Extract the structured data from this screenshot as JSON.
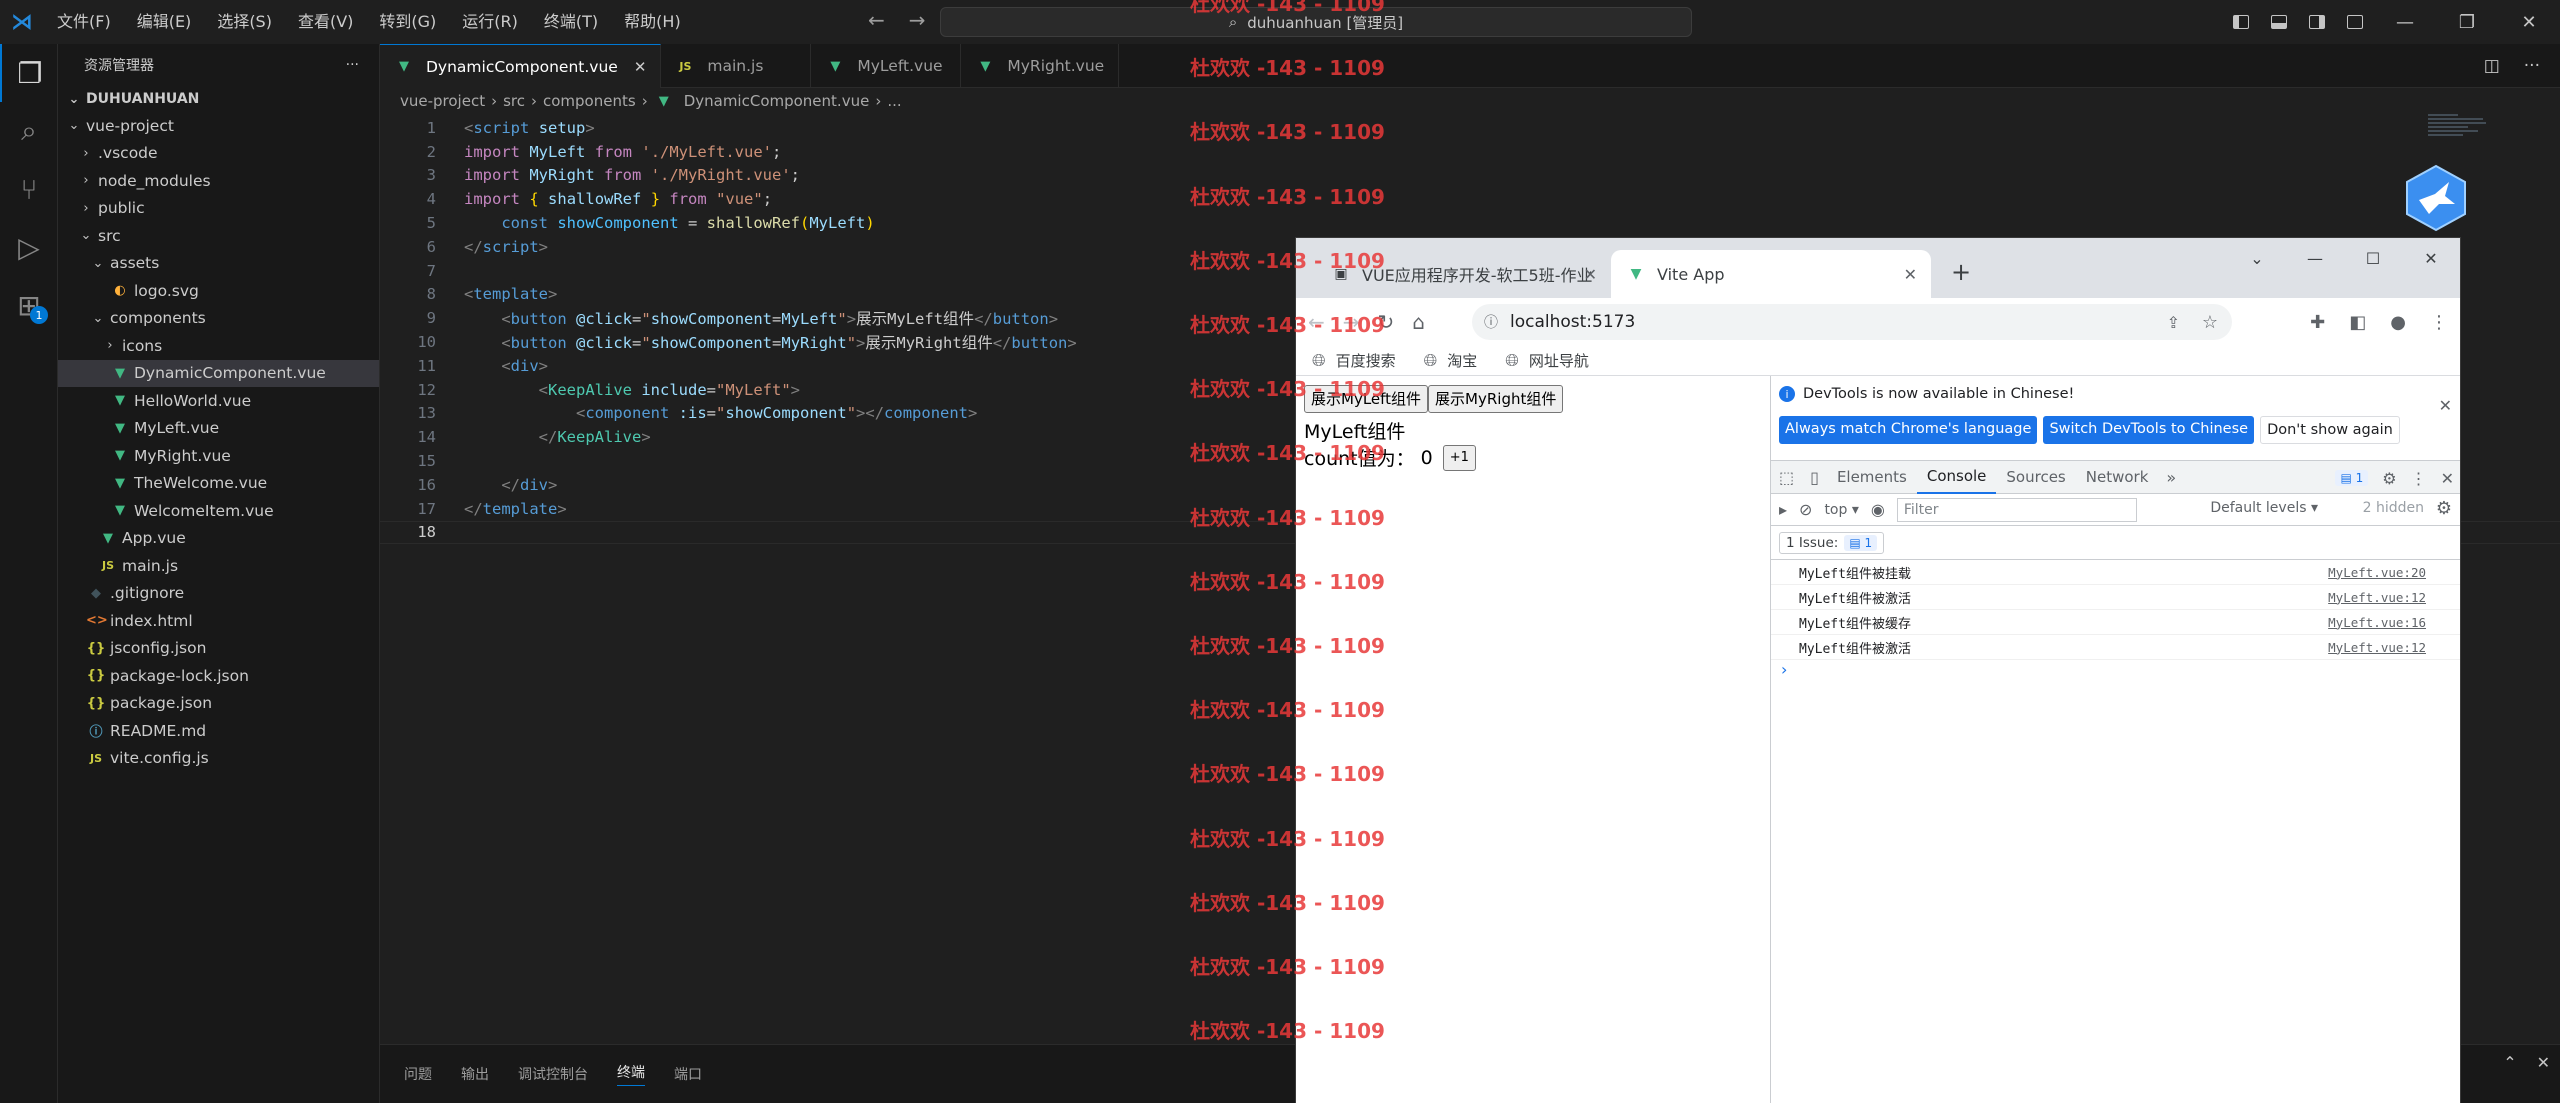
{
  "titlebar": {
    "menus": [
      "文件(F)",
      "编辑(E)",
      "选择(S)",
      "查看(V)",
      "转到(G)",
      "运行(R)",
      "终端(T)",
      "帮助(H)"
    ],
    "search_text": "duhuanhuan [管理员]"
  },
  "sidebar": {
    "title": "资源管理器",
    "workspace": "DUHUANHUAN",
    "tree": [
      {
        "label": "vue-project",
        "depth": 0,
        "chevron": "down",
        "icon": ""
      },
      {
        "label": ".vscode",
        "depth": 1,
        "chevron": "right",
        "icon": ""
      },
      {
        "label": "node_modules",
        "depth": 1,
        "chevron": "right",
        "icon": ""
      },
      {
        "label": "public",
        "depth": 1,
        "chevron": "right",
        "icon": ""
      },
      {
        "label": "src",
        "depth": 1,
        "chevron": "down",
        "icon": ""
      },
      {
        "label": "assets",
        "depth": 2,
        "chevron": "down",
        "icon": ""
      },
      {
        "label": "logo.svg",
        "depth": 3,
        "chevron": "",
        "icon": "svg"
      },
      {
        "label": "components",
        "depth": 2,
        "chevron": "down",
        "icon": ""
      },
      {
        "label": "icons",
        "depth": 3,
        "chevron": "right",
        "icon": ""
      },
      {
        "label": "DynamicComponent.vue",
        "depth": 3,
        "chevron": "",
        "icon": "vue",
        "selected": true
      },
      {
        "label": "HelloWorld.vue",
        "depth": 3,
        "chevron": "",
        "icon": "vue"
      },
      {
        "label": "MyLeft.vue",
        "depth": 3,
        "chevron": "",
        "icon": "vue"
      },
      {
        "label": "MyRight.vue",
        "depth": 3,
        "chevron": "",
        "icon": "vue"
      },
      {
        "label": "TheWelcome.vue",
        "depth": 3,
        "chevron": "",
        "icon": "vue"
      },
      {
        "label": "WelcomeItem.vue",
        "depth": 3,
        "chevron": "",
        "icon": "vue"
      },
      {
        "label": "App.vue",
        "depth": 2,
        "chevron": "",
        "icon": "vue"
      },
      {
        "label": "main.js",
        "depth": 2,
        "chevron": "",
        "icon": "js"
      },
      {
        "label": ".gitignore",
        "depth": 1,
        "chevron": "",
        "icon": "git"
      },
      {
        "label": "index.html",
        "depth": 1,
        "chevron": "",
        "icon": "html"
      },
      {
        "label": "jsconfig.json",
        "depth": 1,
        "chevron": "",
        "icon": "json"
      },
      {
        "label": "package-lock.json",
        "depth": 1,
        "chevron": "",
        "icon": "json"
      },
      {
        "label": "package.json",
        "depth": 1,
        "chevron": "",
        "icon": "json"
      },
      {
        "label": "README.md",
        "depth": 1,
        "chevron": "",
        "icon": "info"
      },
      {
        "label": "vite.config.js",
        "depth": 1,
        "chevron": "",
        "icon": "js"
      }
    ]
  },
  "editor": {
    "tabs": [
      {
        "label": "DynamicComponent.vue",
        "icon": "vue",
        "active": true
      },
      {
        "label": "main.js",
        "icon": "js",
        "active": false
      },
      {
        "label": "MyLeft.vue",
        "icon": "vue",
        "active": false
      },
      {
        "label": "MyRight.vue",
        "icon": "vue",
        "active": false
      }
    ],
    "breadcrumb": [
      "vue-project",
      "src",
      "components",
      "DynamicComponent.vue",
      "..."
    ],
    "line_numbers": [
      "1",
      "2",
      "3",
      "4",
      "5",
      "6",
      "7",
      "8",
      "9",
      "10",
      "11",
      "12",
      "13",
      "14",
      "15",
      "16",
      "17",
      "18"
    ],
    "current_line": "18"
  },
  "panel": {
    "tabs": [
      "问题",
      "输出",
      "调试控制台",
      "终端",
      "端口"
    ],
    "active": "终端"
  },
  "browser": {
    "tabs": [
      {
        "title": "VUE应用程序开发-软工5班-作业",
        "active": false
      },
      {
        "title": "Vite App",
        "active": true
      }
    ],
    "url": "localhost:5173",
    "bookmarks": [
      "百度搜索",
      "淘宝",
      "网址导航"
    ],
    "page": {
      "btn_left": "展示MyLeft组件",
      "btn_right": "展示MyRight组件",
      "component_title": "MyLeft组件",
      "count_label": "count值为：",
      "count_value": "0",
      "inc_button": "+1"
    },
    "devtools": {
      "info_text": "DevTools is now available in Chinese!",
      "info_buttons": [
        "Always match Chrome's language",
        "Switch DevTools to Chinese",
        "Don't show again"
      ],
      "tabs": [
        "Elements",
        "Console",
        "Sources",
        "Network"
      ],
      "active_tab": "Console",
      "issue_badge": "1",
      "context": "top",
      "filter_placeholder": "Filter",
      "levels": "Default levels",
      "hidden": "2 hidden",
      "issues_label": "1 Issue:",
      "issues_count": "1",
      "logs": [
        {
          "msg": "MyLeft组件被挂载",
          "src": "MyLeft.vue:20"
        },
        {
          "msg": "MyLeft组件被激活",
          "src": "MyLeft.vue:12"
        },
        {
          "msg": "MyLeft组件被缓存",
          "src": "MyLeft.vue:16"
        },
        {
          "msg": "MyLeft组件被激活",
          "src": "MyLeft.vue:12"
        }
      ]
    }
  },
  "watermark": {
    "text": "杜欢欢 -143 - 1109",
    "count": 17
  },
  "colors": {
    "accent": "#0078d4",
    "vue_green": "#41b883",
    "watermark": "#e83838"
  }
}
